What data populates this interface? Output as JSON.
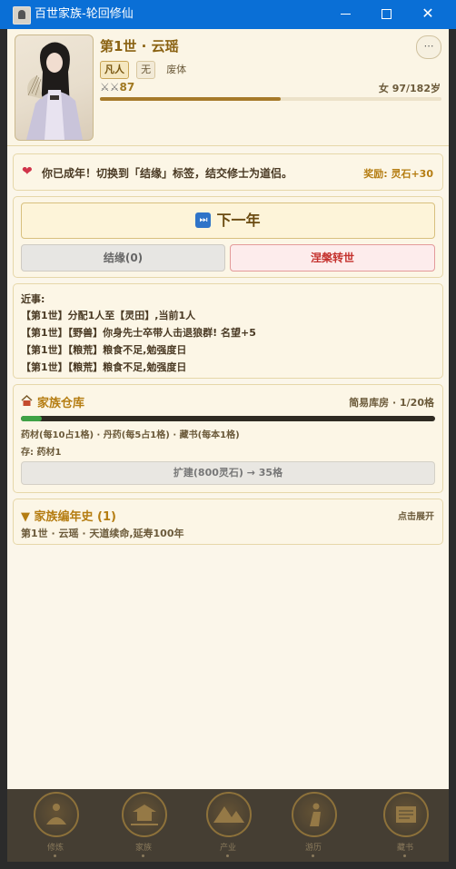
{
  "window": {
    "title": "百世家族-轮回修仙",
    "minimize": "minimize",
    "maximize": "maximize",
    "close": "✕"
  },
  "character": {
    "name": "第1世 · 云瑶",
    "tags": [
      "凡人",
      "无",
      "废体"
    ],
    "header_button": "⋯",
    "power": "87",
    "age": "女 97/182岁",
    "age_progress": 0.53
  },
  "notice": {
    "icon": "heart-icon",
    "text": "你已成年！切换到「结缘」标签，结交修士为道侣。",
    "reward": "奖励: 灵石+30"
  },
  "actions": {
    "next_year_icon": "⏭",
    "next_year": "下一年",
    "marry": "结缘(0)",
    "reborn": "涅槃转世"
  },
  "log": {
    "title": "近事:",
    "lines": [
      "【第1世】分配1人至【灵田】,当前1人",
      "【第1世】【野兽】你身先士卒带人击退狼群! 名望+5",
      "【第1世】【粮荒】粮食不足,勉强度日",
      "【第1世】【粮荒】粮食不足,勉强度日"
    ]
  },
  "warehouse": {
    "title": "家族仓库",
    "capacity": "简易库房 · 1/20格",
    "fill": 0.05,
    "note": "药材(每10占1格) · 丹药(每5占1格) · 藏书(每本1格)",
    "stock": "存: 药材1",
    "expand": "扩建(800灵石) → 35格"
  },
  "chronicle": {
    "title": "▼ 家族编年史 (1)",
    "hint": "点击展开",
    "entry": "第1世 · 云瑶 · 天道续命,延寿100年"
  },
  "nav": {
    "items": [
      {
        "label": "修炼",
        "icon": "meditation-emblem-icon"
      },
      {
        "label": "家族",
        "icon": "pavilion-emblem-icon"
      },
      {
        "label": "产业",
        "icon": "mountain-emblem-icon"
      },
      {
        "label": "游历",
        "icon": "wanderer-emblem-icon"
      },
      {
        "label": "藏书",
        "icon": "scroll-emblem-icon"
      }
    ]
  },
  "colors": {
    "titlebar": "#0a6fd6",
    "accent_gold": "#b57d12",
    "reborn_red": "#c4312d",
    "warehouse_fill": "#3fa246",
    "nav_bg": "#453e33"
  }
}
